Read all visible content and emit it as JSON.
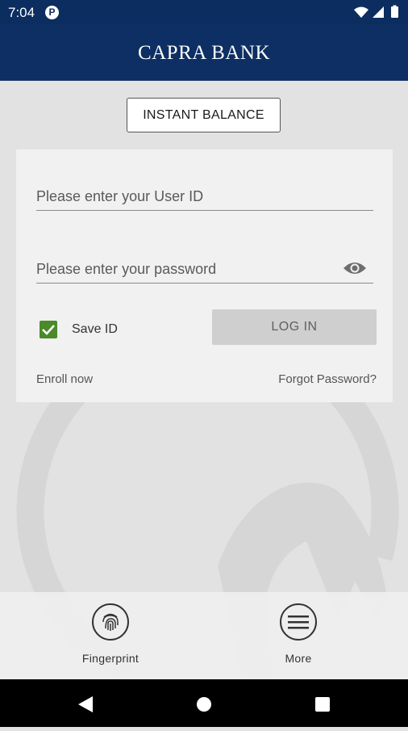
{
  "status_bar": {
    "time": "7:04",
    "notification_icon": "p-badge-icon",
    "icons": [
      "wifi-icon",
      "signal-icon",
      "battery-icon"
    ]
  },
  "header": {
    "title": "CAPRA BANK"
  },
  "instant_balance": {
    "label": "INSTANT BALANCE"
  },
  "login": {
    "user_id_placeholder": "Please enter your User ID",
    "password_placeholder": "Please enter your password",
    "save_id_label": "Save ID",
    "save_id_checked": true,
    "login_label": "LOG IN",
    "enroll_label": "Enroll now",
    "forgot_label": "Forgot Password?"
  },
  "bottom": {
    "fingerprint_label": "Fingerprint",
    "more_label": "More"
  },
  "colors": {
    "brand_navy": "#0d2f63",
    "checkbox_green": "#4a8a2a"
  }
}
